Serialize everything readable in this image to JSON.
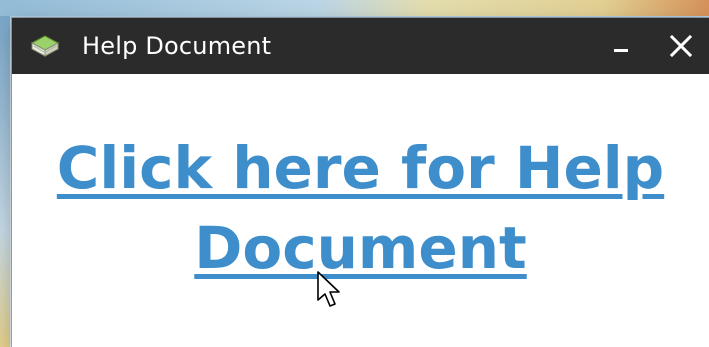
{
  "window": {
    "title": "Help Document",
    "icon": "green-book-icon",
    "controls": {
      "minimize_label": "–",
      "close_label": "✕"
    }
  },
  "content": {
    "link_text": "Click here for Help Document"
  },
  "colors": {
    "titlebar": "#2b2b2b",
    "link": "#3d8ecb",
    "window_bg": "#ffffff"
  }
}
